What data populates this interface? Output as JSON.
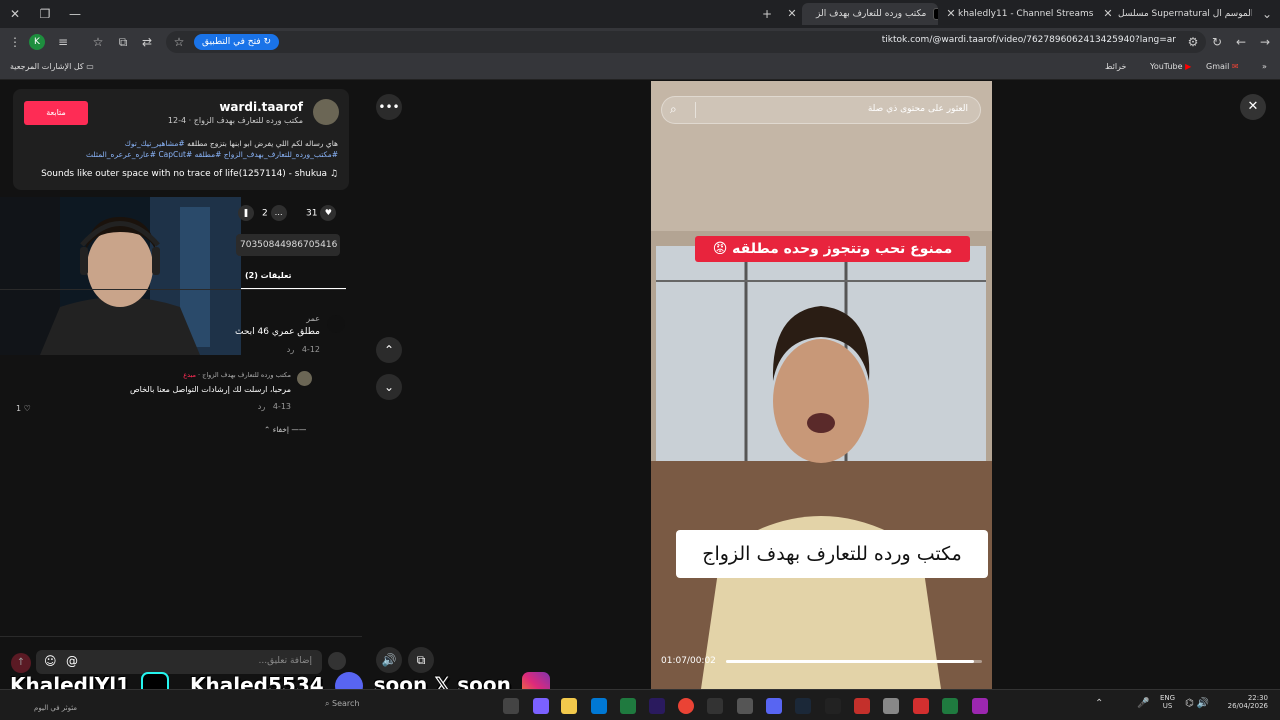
{
  "tabs": [
    {
      "title": "مسلسل Supernatural الموسم ال",
      "active": false
    },
    {
      "title": "khaledly11 - Channel Streams o",
      "active": false
    },
    {
      "title": "مكتب ورده للتعارف بهدف الز",
      "active": true
    }
  ],
  "toolbar": {
    "url": "tiktok.com/@wardi.taarof/video/7627896062413425940?lang=ar",
    "open_app": "فتح في التطبيق",
    "profile_initial": "K"
  },
  "bookmarks": {
    "all_bookmarks": "كل الإشارات المرجعية",
    "items": [
      "Gmail",
      "YouTube",
      "خرائط"
    ]
  },
  "post": {
    "username": "wardi.taarof",
    "nickname": "مكتب ورده للتعارف بهدف الزواج · 4-12",
    "follow": "متابعة",
    "desc_line1": "هاي رساله لكم اللي يفرض ابو ابنها بتزوج مطلقه",
    "desc_tag1": "#مشاهير_تيك_توك",
    "desc_line2_tags": "#مكتب_ورده_للتعارف_بهدف_الزواج #مطلقه #CapCut #عاره_عرعره_المثلث",
    "music": "Sounds like outer space with no trace of life(1257114) - shukua",
    "likes": "31",
    "comments": "2",
    "link_fragment": "70350844986705416",
    "comments_tab": "تعليقات (2)"
  },
  "comments": [
    {
      "author": "عمر",
      "text": "مطلق عمري 46 ابحث",
      "date": "4-12",
      "reply": "رد"
    },
    {
      "author": "مكتب ورده للتعارف بهدف الزواج",
      "badge": "مبدع",
      "text": "مرحبا، ارسلت لك إرشادات التواصل معنا بالخاص",
      "date": "4-13",
      "reply": "رد",
      "likes": "1"
    }
  ],
  "hide_label": "إخفاء",
  "comment_placeholder": "إضافة تعليق...",
  "video": {
    "search_placeholder": "العثور على محتوى ذي صلة",
    "overlay_top": "ممنوع تحب وتتجوز وحده مطلقه 😡",
    "overlay_bottom": "مكتب ورده للتعارف بهدف الزواج",
    "timecode": "01:07/00:02",
    "progress": 0.97
  },
  "streamer": {
    "name1": "KhaledlYl1",
    "name2": "Khaled5534",
    "soon1": "soon",
    "soon2": "soon"
  },
  "taskbar": {
    "search": "Search",
    "weather": "مئوثر في اليوم",
    "lang_top": "ENG",
    "lang_bottom": "US",
    "time": "22:30",
    "date": "26/04/2026"
  },
  "colors": {
    "tiktok_red": "#fe2c55",
    "chrome_blue": "#1a73e8"
  }
}
